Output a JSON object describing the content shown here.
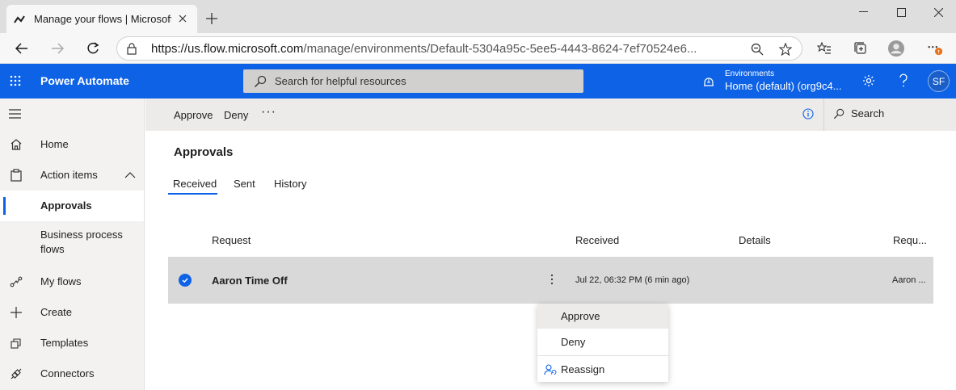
{
  "browser": {
    "tab_title": "Manage your flows | Microsoft Power Automate",
    "url_host": "https://us.flow.microsoft.com",
    "url_path": "/manage/environments/Default-5304a95c-5ee5-4443-8624-7ef70524e6...",
    "badge_color": "#e8701a"
  },
  "header": {
    "brand": "Power Automate",
    "search_placeholder": "Search for helpful resources",
    "env_label": "Environments",
    "env_value": "Home (default) (org9c4...",
    "avatar_initials": "SF",
    "accent": "#0d62e6"
  },
  "nav": {
    "items": [
      {
        "label": "Home",
        "icon": "home-icon"
      },
      {
        "label": "Action items",
        "icon": "clipboard-icon"
      },
      {
        "label": "Approvals",
        "icon": ""
      },
      {
        "label": "Business process flows",
        "icon": ""
      },
      {
        "label": "My flows",
        "icon": "flow-icon"
      },
      {
        "label": "Create",
        "icon": "plus-icon"
      },
      {
        "label": "Templates",
        "icon": "templates-icon"
      },
      {
        "label": "Connectors",
        "icon": "connector-icon"
      }
    ]
  },
  "cmdbar": {
    "approve": "Approve",
    "deny": "Deny",
    "more": "···",
    "search": "Search"
  },
  "page": {
    "title": "Approvals",
    "tabs": [
      "Received",
      "Sent",
      "History"
    ],
    "selected_tab": "Received"
  },
  "table": {
    "columns": [
      "Request",
      "Received",
      "Details",
      "Requ..."
    ],
    "rows": [
      {
        "request": "Aaron Time Off",
        "received": "Jul 22, 06:32 PM (6 min ago)",
        "requestor": "Aaron ..."
      }
    ]
  },
  "context_menu": {
    "items": [
      "Approve",
      "Deny",
      "Reassign"
    ]
  }
}
